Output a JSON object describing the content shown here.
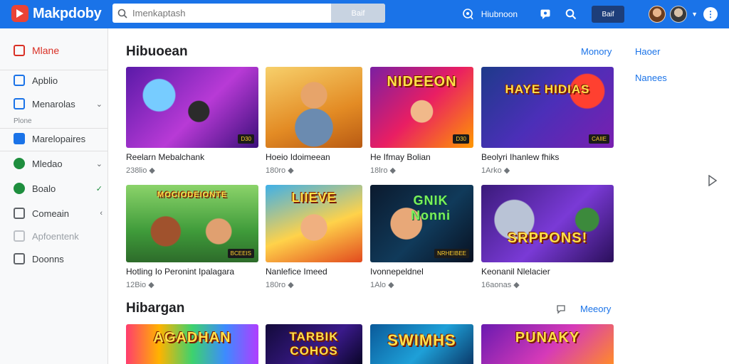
{
  "header": {
    "app_name": "Makpdoby",
    "search_placeholder": "Imenkaptash",
    "search_button": "Baif",
    "link_text": "Hiubnoon",
    "chip_text": "Baif"
  },
  "sidebar": {
    "items": [
      {
        "label": "Mlane",
        "icon": "home-icon",
        "active": true
      },
      {
        "label": "Apblio",
        "icon": "apps-icon"
      },
      {
        "label": "Menarolas",
        "icon": "library-icon",
        "chevron": "chevron-down-icon"
      },
      {
        "label": "Marelopaires",
        "icon": "store-icon"
      },
      {
        "label": "Mledao",
        "icon": "play-icon",
        "chevron": "chevron-down-icon"
      },
      {
        "label": "Boalo",
        "icon": "game-icon",
        "check": true
      },
      {
        "label": "Comeain",
        "icon": "settings-icon",
        "chevron": "chevron-left-icon"
      },
      {
        "label": "Apfoentenk",
        "icon": "folder-icon",
        "disabled": true
      },
      {
        "label": "Doonns",
        "icon": "docs-icon"
      }
    ],
    "heading": "Plone"
  },
  "section1": {
    "title": "Hibuoean",
    "links": [
      "Monory",
      "Haoer",
      "Nanees"
    ],
    "cards": [
      {
        "title": "Reelarn Mebalchank",
        "meta": "238lio",
        "art": "purple",
        "badge": "D30"
      },
      {
        "title": "Hoeio Idoimeean",
        "meta": "180ro",
        "art": "orange",
        "badge": ""
      },
      {
        "title": "He Ifmay Bolian",
        "meta": "18lro",
        "art": "pink",
        "badge": "D30",
        "overlay": "NIDEEON"
      },
      {
        "title": "Beolyri Ihanlew fhiks",
        "meta": "1Arko",
        "art": "blue",
        "badge": "CAIIE",
        "overlay": "HAYE HIDIAS"
      },
      {
        "title": "Hotling Io Peronint Ipalagara",
        "meta": "12Bio",
        "art": "green",
        "badge": "BCEEIS",
        "overlay": "MOCIODEIONTE"
      },
      {
        "title": "Nanlefice Imeed",
        "meta": "180ro",
        "art": "sunny",
        "badge": "",
        "overlay": "LIIEVE"
      },
      {
        "title": "Ivonnepeldnel",
        "meta": "1Alo",
        "art": "dark",
        "badge": "NRHEIBEE",
        "overlay": "GNIK Nonni"
      },
      {
        "title": "Keonanil Nlelacier",
        "meta": "16aonas",
        "art": "violet",
        "badge": "",
        "overlay": "SRPPONS!"
      }
    ]
  },
  "section2": {
    "title": "Hibargan",
    "link": "Meeory",
    "cards": [
      {
        "art": "rainbow",
        "overlay": "AGADHAN"
      },
      {
        "art": "night",
        "overlay": "TARBIK COHOS"
      },
      {
        "art": "sky",
        "overlay": "SWIMHS"
      },
      {
        "art": "magenta",
        "overlay": "PUNAKY"
      }
    ]
  },
  "colors": {
    "accent": "#1a73e8",
    "active": "#d93025"
  }
}
